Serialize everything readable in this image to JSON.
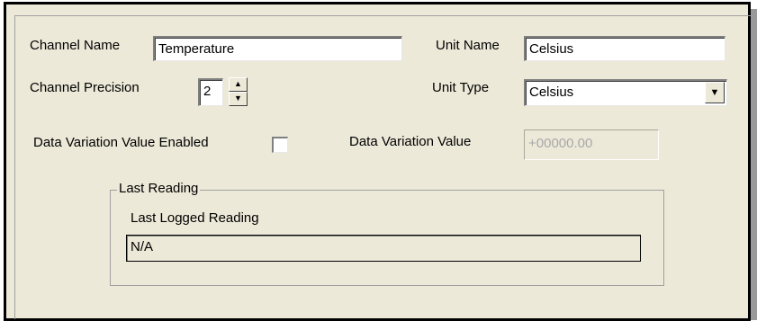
{
  "channel_name": {
    "label": "Channel Name",
    "value": "Temperature"
  },
  "unit_name": {
    "label": "Unit Name",
    "value": "Celsius"
  },
  "channel_precision": {
    "label": "Channel Precision",
    "value": "2"
  },
  "unit_type": {
    "label": "Unit Type",
    "value": "Celsius"
  },
  "data_variation_enabled": {
    "label": "Data Variation Value Enabled",
    "checked": false
  },
  "data_variation_value": {
    "label": "Data Variation Value",
    "value": "+00000.00"
  },
  "last_reading": {
    "group_title": "Last Reading",
    "label": "Last Logged Reading",
    "value": "N/A"
  },
  "icons": {
    "spin_up": "▲",
    "spin_down": "▼",
    "dropdown": "▼"
  }
}
